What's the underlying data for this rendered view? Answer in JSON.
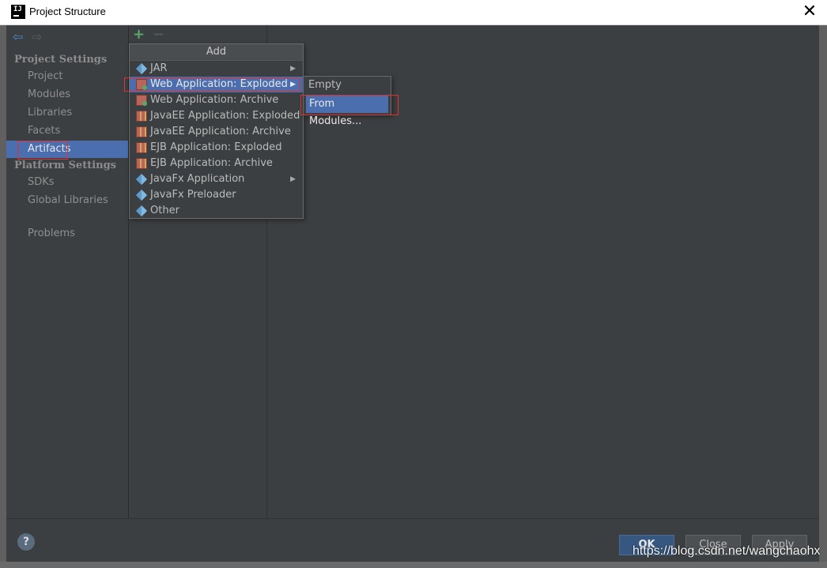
{
  "window": {
    "title": "Project Structure"
  },
  "toolbar": {
    "add_symbol": "+",
    "remove_symbol": "−"
  },
  "sidebar": {
    "project_settings_header": "Project Settings",
    "project_settings_items": [
      {
        "label": "Project"
      },
      {
        "label": "Modules"
      },
      {
        "label": "Libraries"
      },
      {
        "label": "Facets"
      },
      {
        "label": "Artifacts"
      }
    ],
    "platform_settings_header": "Platform Settings",
    "platform_settings_items": [
      {
        "label": "SDKs"
      },
      {
        "label": "Global Libraries"
      }
    ],
    "problems_label": "Problems"
  },
  "add_menu": {
    "title": "Add",
    "items": [
      {
        "label": "JAR",
        "icon": "jar-icon",
        "submenu": true
      },
      {
        "label": "Web Application: Exploded",
        "icon": "web-app-icon",
        "submenu": true,
        "selected": true
      },
      {
        "label": "Web Application: Archive",
        "icon": "web-app-icon"
      },
      {
        "label": "JavaEE Application: Exploded",
        "icon": "javaee-icon"
      },
      {
        "label": "JavaEE Application: Archive",
        "icon": "javaee-icon"
      },
      {
        "label": "EJB Application: Exploded",
        "icon": "ejb-icon"
      },
      {
        "label": "EJB Application: Archive",
        "icon": "ejb-icon"
      },
      {
        "label": "JavaFx Application",
        "icon": "javafx-icon",
        "submenu": true
      },
      {
        "label": "JavaFx Preloader",
        "icon": "javafx-icon"
      },
      {
        "label": "Other",
        "icon": "other-icon"
      }
    ]
  },
  "submenu": {
    "items": [
      {
        "label": "Empty"
      },
      {
        "label": "From Modules...",
        "selected": true
      }
    ]
  },
  "footer": {
    "help_symbol": "?",
    "ok_label": "OK",
    "close_label": "Close",
    "apply_label": "Apply"
  },
  "watermark": "https://blog.csdn.net/wangchaohx",
  "colors": {
    "selection": "#4b6eaf",
    "background": "#3c3f41",
    "highlight_box": "#e03030"
  }
}
